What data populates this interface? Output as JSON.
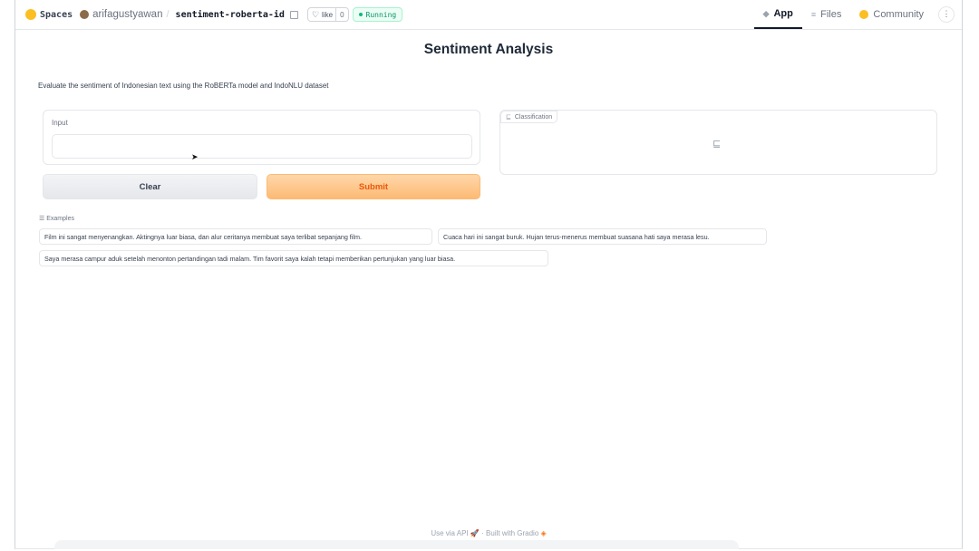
{
  "header": {
    "spaces_label": "Spaces",
    "owner": "arifagustyawan",
    "separator": "/",
    "repo": "sentiment-roberta-id",
    "like_label": "like",
    "like_count": "0",
    "status": "Running",
    "tabs": [
      {
        "label": "App",
        "icon": "app-icon",
        "active": true
      },
      {
        "label": "Files",
        "icon": "files-icon",
        "active": false
      },
      {
        "label": "Community",
        "icon": "community-icon",
        "active": false
      }
    ]
  },
  "main": {
    "title": "Sentiment Analysis",
    "description": "Evaluate the sentiment of Indonesian text using the RoBERTa model and IndoNLU dataset",
    "input_label": "Input",
    "input_value": "",
    "clear_label": "Clear",
    "submit_label": "Submit",
    "classification_label": "Classification"
  },
  "examples": {
    "label": "Examples",
    "items": [
      "Film ini sangat menyenangkan. Aktingnya luar biasa, dan alur ceritanya membuat saya terlibat sepanjang film.",
      "Cuaca hari ini sangat buruk. Hujan terus-menerus membuat suasana hati saya merasa lesu.",
      "Saya merasa campur aduk setelah menonton pertandingan tadi malam. Tim favorit saya kalah tetapi memberikan pertunjukan yang luar biasa."
    ]
  },
  "footer": {
    "api_label": "Use via API",
    "dot": "·",
    "built_label": "Built with Gradio"
  },
  "colors": {
    "accent": "#f97316",
    "submit_bg": "#fdba74",
    "running": "#059669"
  }
}
